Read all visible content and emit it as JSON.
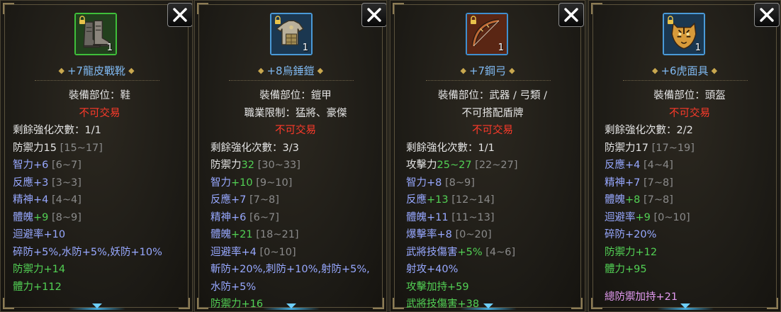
{
  "panels": [
    {
      "count": "1",
      "name": "+7龍皮戰靴",
      "slot": "裝備部位：鞋",
      "trade": "不可交易",
      "enhance": "剩餘強化次數：1/1",
      "defense_label": "防禦力15",
      "defense_range": "[15~17]",
      "stats": [
        {
          "label": "智力+6",
          "range": "[6~7]"
        },
        {
          "label": "反應+3",
          "range": "[3~3]"
        },
        {
          "label": "精神+4",
          "range": "[4~4]"
        },
        {
          "label": "體魄",
          "value": "+9",
          "range": "[8~9]"
        },
        {
          "label": "迴避率+10",
          "range": ""
        }
      ],
      "resists": "碎防+5%,水防+5%,妖防+10%",
      "bonus": [
        "防禦力+14",
        "體力+112"
      ]
    },
    {
      "count": "1",
      "name": "+8烏錘鎧",
      "slot": "裝備部位：鎧甲",
      "job": "職業限制：猛將、豪傑",
      "trade": "不可交易",
      "enhance": "剩餘強化次數：3/3",
      "defense_label": "防禦力",
      "defense_value": "32",
      "defense_range": "[30~33]",
      "stats": [
        {
          "label": "智力",
          "value": "+10",
          "range": "[9~10]"
        },
        {
          "label": "反應+7",
          "range": "[7~8]"
        },
        {
          "label": "精神+6",
          "range": "[6~7]"
        },
        {
          "label": "體魄",
          "value": "+21",
          "range": "[18~21]"
        },
        {
          "label": "迴避率+4",
          "range": "[0~10]"
        }
      ],
      "resists": [
        "斬防+20%,刺防+10%,射防+5%,",
        "水防+5%"
      ],
      "bonus": [
        "防禦力+16"
      ]
    },
    {
      "count": "1",
      "name": "+7鋼弓",
      "slot": [
        "裝備部位：武器 / 弓類 /",
        "不可搭配盾牌"
      ],
      "trade": "不可交易",
      "enhance": "剩餘強化次數：1/1",
      "attack_label": "攻擊力",
      "attack_value": "25~27",
      "attack_range": "[22~27]",
      "stats": [
        {
          "label": "智力+8",
          "range": "[8~9]"
        },
        {
          "label": "反應",
          "value": "+13",
          "range": "[12~14]"
        },
        {
          "label": "體魄+11",
          "range": "[11~13]"
        },
        {
          "label": "爆擊率+8",
          "range": "[0~20]"
        },
        {
          "label": "武將技傷害",
          "value": "+5%",
          "range": "[4~6]"
        },
        {
          "label": "射攻+40%",
          "range": ""
        }
      ],
      "bonus": [
        "攻擊加持+59",
        "武將技傷害+38"
      ]
    },
    {
      "count": "1",
      "name": "+6虎面具",
      "slot": "裝備部位：頭盔",
      "trade": "不可交易",
      "enhance": "剩餘強化次數：2/2",
      "defense_label": "防禦力17",
      "defense_range": "[17~19]",
      "stats": [
        {
          "label": "反應+4",
          "range": "[4~4]"
        },
        {
          "label": "精神+7",
          "range": "[7~8]"
        },
        {
          "label": "體魄",
          "value": "+8",
          "range": "[7~8]"
        },
        {
          "label": "迴避率",
          "value": "+9",
          "range": "[0~10]"
        }
      ],
      "resists": "碎防+20%",
      "bonus": [
        "防禦力+12",
        "體力+95"
      ],
      "set_bonus": "總防禦加持+21"
    }
  ],
  "colors": {
    "title_blue": "#7fb8f0",
    "no_trade_red": "#ff3a2a",
    "stat_blue": "#97a8ff",
    "bonus_green": "#52d054",
    "range_gray": "#8a8a8a",
    "set_pink": "#e29af0"
  },
  "icons": [
    "close-icon",
    "lock-icon",
    "boots-icon",
    "armor-icon",
    "bow-icon",
    "tiger-mask-icon",
    "scroll-down-icon"
  ]
}
